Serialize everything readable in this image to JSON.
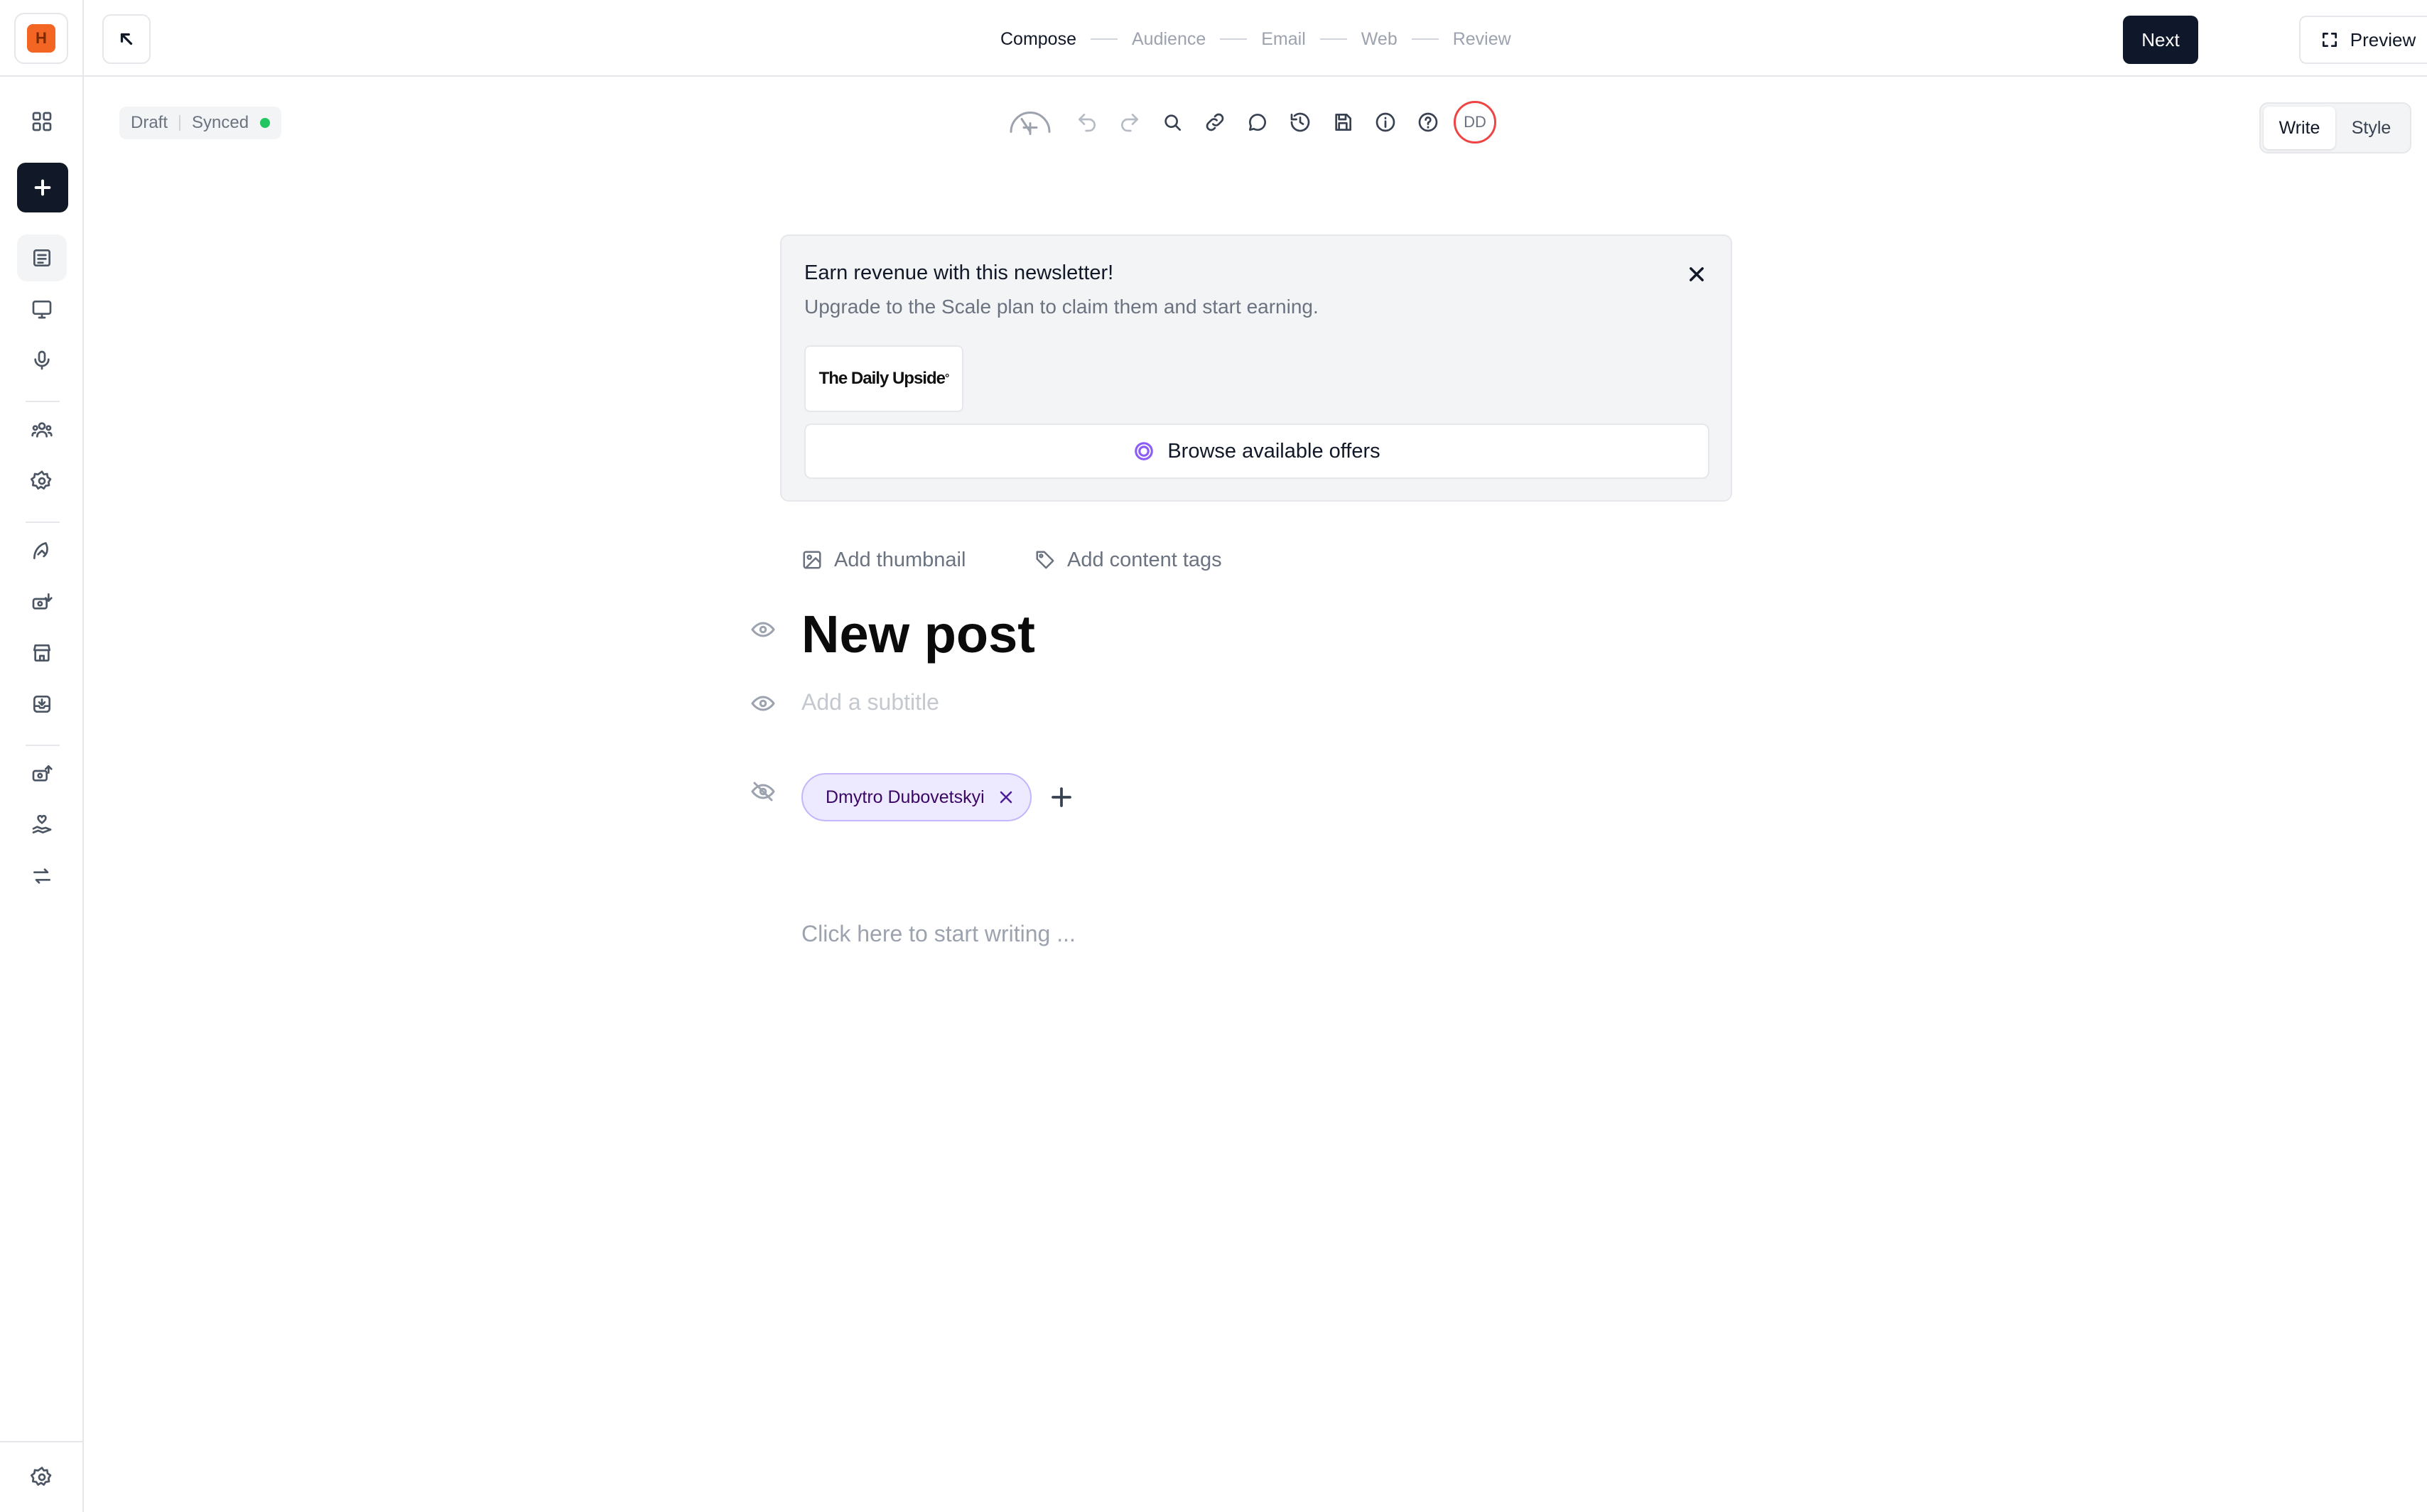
{
  "app": {
    "logo_letter": "H",
    "accent_color": "#f26522",
    "primary_dark": "#0f172a"
  },
  "sidebar": {
    "icons": [
      "dashboard-grid-icon",
      "plus-icon",
      "posts-icon",
      "website-icon",
      "podcast-icon",
      "audience-icon",
      "settings-icon",
      "growth-icon",
      "monetize-icon",
      "shop-icon",
      "inbox-icon",
      "boost-icon",
      "donations-icon",
      "sync-icon",
      "bottom-settings-icon"
    ]
  },
  "topbar": {
    "steps": [
      {
        "label": "Compose",
        "current": true
      },
      {
        "label": "Audience",
        "current": false
      },
      {
        "label": "Email",
        "current": false
      },
      {
        "label": "Web",
        "current": false
      },
      {
        "label": "Review",
        "current": false
      }
    ],
    "next_label": "Next",
    "preview_label": "Preview"
  },
  "status": {
    "draft": "Draft",
    "synced": "Synced",
    "synced_color": "#22c55e"
  },
  "toolbar": {
    "avatar_initials": "DD",
    "avatar_ring_color": "#ef4444"
  },
  "mode_toggle": {
    "write": "Write",
    "style": "Style",
    "active": "Write"
  },
  "promo": {
    "title": "Earn revenue with this newsletter!",
    "subtitle": "Upgrade to the Scale plan to claim them and start earning.",
    "brand": "The Daily Upside",
    "brand_mark": "°",
    "browse_label": "Browse available offers"
  },
  "post": {
    "add_thumbnail": "Add thumbnail",
    "add_tags": "Add content tags",
    "title": "New post",
    "subtitle_placeholder": "Add a subtitle",
    "author": "Dmytro Dubovetskyi",
    "body_placeholder": "Click here to start writing ..."
  }
}
